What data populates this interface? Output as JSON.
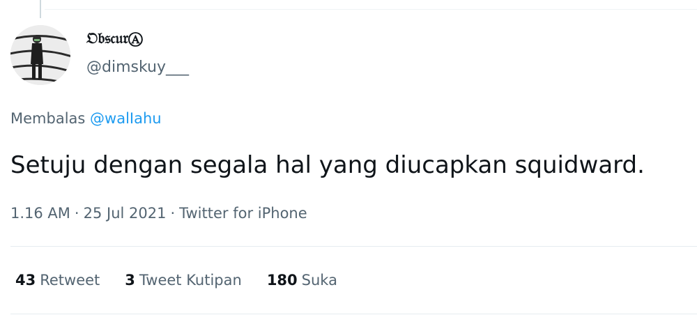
{
  "author": {
    "display_name": "𝔒𝔟𝔰𝔠𝔲𝔯Ⓐ",
    "handle": "@dimskuy___"
  },
  "reply": {
    "prefix": "Membalas",
    "mention": "@walIahu"
  },
  "tweet": {
    "text": "Setuju dengan segala hal yang diucapkan squidward."
  },
  "meta": {
    "time": "1.16 AM",
    "separator": "·",
    "date": "25 Jul 2021",
    "source": "Twitter for iPhone"
  },
  "stats": [
    {
      "count": "43",
      "label": "Retweet"
    },
    {
      "count": "3",
      "label": "Tweet Kutipan"
    },
    {
      "count": "180",
      "label": "Suka"
    }
  ]
}
